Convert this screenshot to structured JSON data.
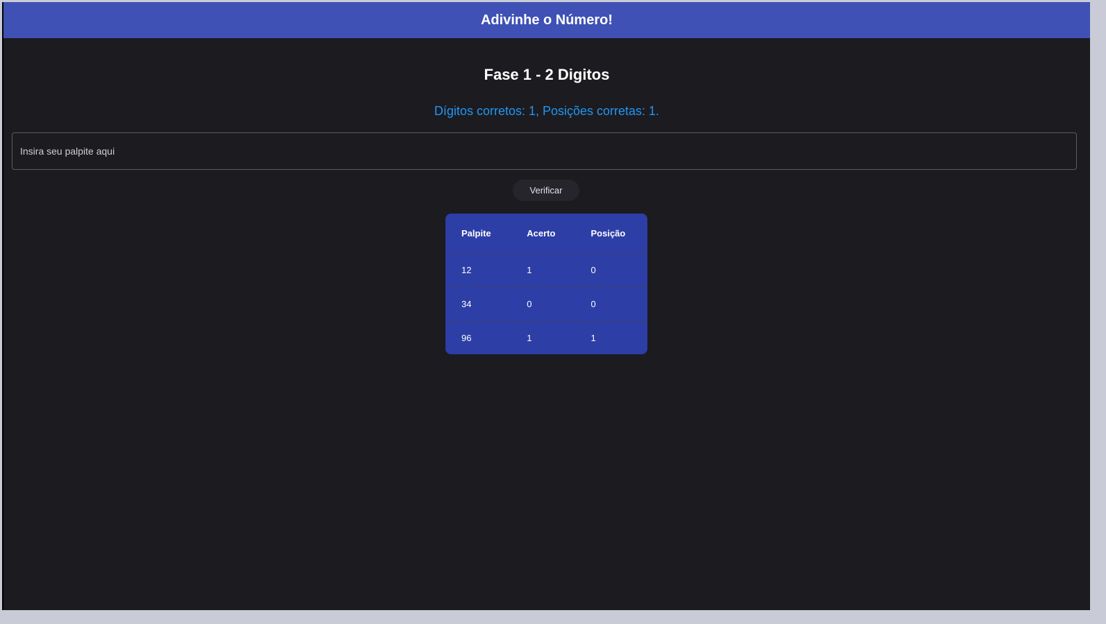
{
  "appbar": {
    "title": "Adivinhe o Número!"
  },
  "phase_title": "Fase 1 - 2 Digitos",
  "feedback": "Dígitos corretos: 1, Posições corretas: 1.",
  "guess_input": {
    "placeholder": "Insira seu palpite aqui",
    "value": ""
  },
  "verify_button": "Verificar",
  "history": {
    "headers": [
      "Palpite",
      "Acerto",
      "Posição"
    ],
    "rows": [
      [
        "12",
        "1",
        "0"
      ],
      [
        "34",
        "0",
        "0"
      ],
      [
        "96",
        "1",
        "1"
      ]
    ]
  },
  "colors": {
    "appbar": "#3f51b5",
    "background": "#1c1b1f",
    "feedback": "#2196f3",
    "table": "#2d3ea6"
  }
}
